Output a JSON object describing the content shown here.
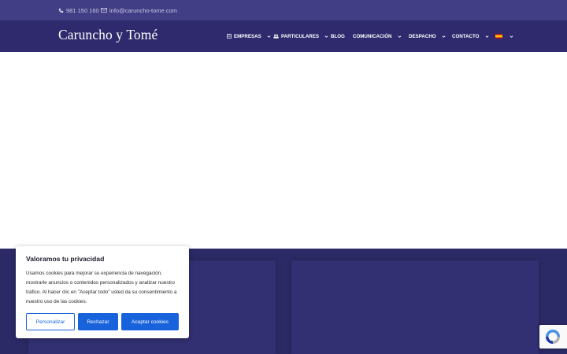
{
  "topbar": {
    "phone": "981 150 160",
    "email": "info@caruncho-tome.com",
    "phone_icon": "phone-icon",
    "email_icon": "envelope-icon"
  },
  "header": {
    "logo": "Caruncho y Tomé",
    "nav": [
      {
        "label": "EMPRESAS",
        "icon": "building-icon",
        "dropdown": true
      },
      {
        "label": "PARTICULARES",
        "icon": "users-icon",
        "dropdown": true
      },
      {
        "label": "BLOG",
        "dropdown": false
      },
      {
        "label": "COMUNICACIÓN",
        "dropdown": true
      },
      {
        "label": "DESPACHO",
        "dropdown": true
      },
      {
        "label": "CONTACTO",
        "dropdown": true
      },
      {
        "label": "",
        "icon": "spain-flag-icon",
        "dropdown": true
      }
    ]
  },
  "cookie_banner": {
    "title": "Valoramos tu privacidad",
    "text": "Usamos cookies para mejorar su experiencia de navegación, mostrarle anuncios o contenidos personalizados y analizar nuestro tráfico. Al hacer clic en \"Aceptar todo\" usted da su consentimiento a nuestro uso de las cookies.",
    "customize_label": "Personalizar",
    "reject_label": "Rechazar",
    "accept_label": "Aceptar cookies"
  },
  "colors": {
    "topbar": "#423e85",
    "header": "#2e2a6d",
    "band": "#2c2a66",
    "accent": "#1863dc"
  }
}
